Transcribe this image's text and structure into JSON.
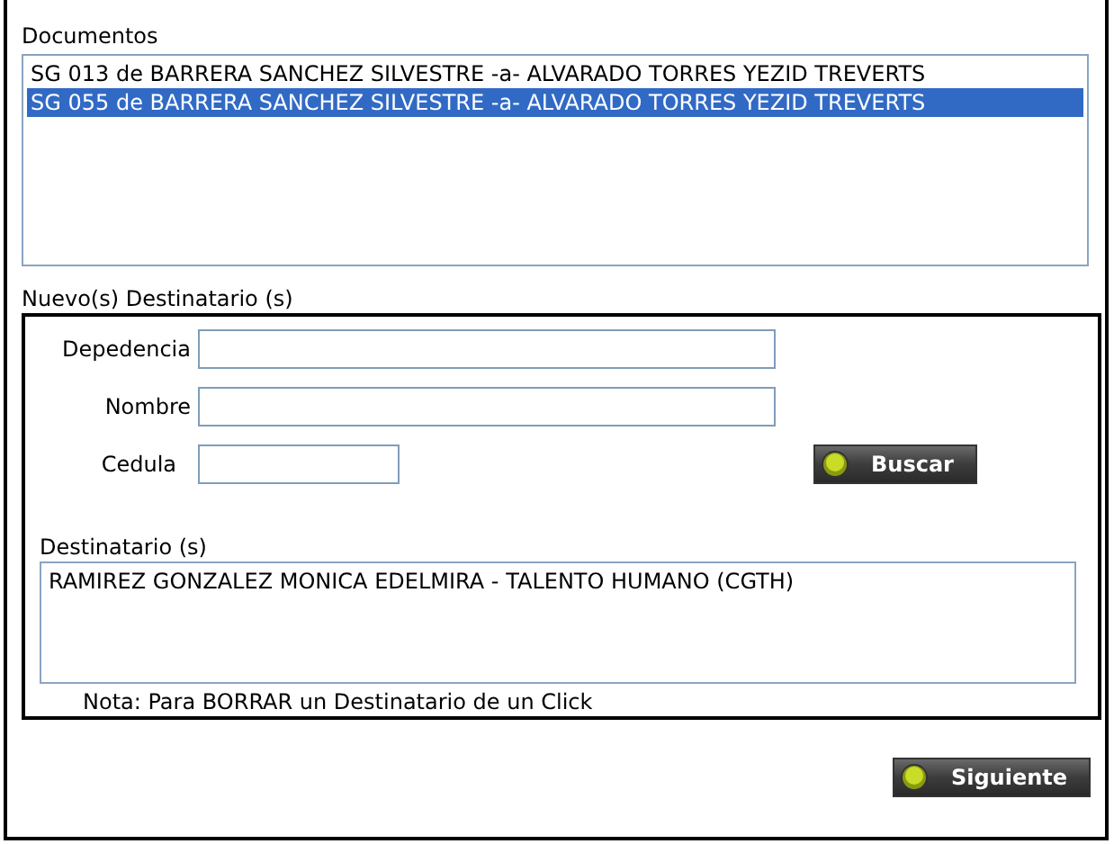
{
  "documentos": {
    "label": "Documentos",
    "items": [
      {
        "text": "SG 013 de BARRERA SANCHEZ SILVESTRE -a- ALVARADO TORRES YEZID TREVERTS",
        "selected": false
      },
      {
        "text": "SG 055 de BARRERA SANCHEZ SILVESTRE -a- ALVARADO TORRES YEZID TREVERTS",
        "selected": true
      }
    ]
  },
  "nuevos": {
    "label": "Nuevo(s) Destinatario (s)",
    "fields": [
      {
        "label": "Depedencia",
        "kind": "wide"
      },
      {
        "label": "Nombre",
        "kind": "wide"
      },
      {
        "label": "Cedula",
        "kind": "narrow"
      }
    ],
    "search_button": "Buscar",
    "destinatarios": {
      "label": "Destinatario (s)",
      "items": [
        "RAMIREZ GONZALEZ MONICA EDELMIRA - TALENTO HUMANO (CGTH)"
      ]
    },
    "note": "Nota: Para BORRAR un Destinatario de un Click"
  },
  "next_button": "Siguiente"
}
